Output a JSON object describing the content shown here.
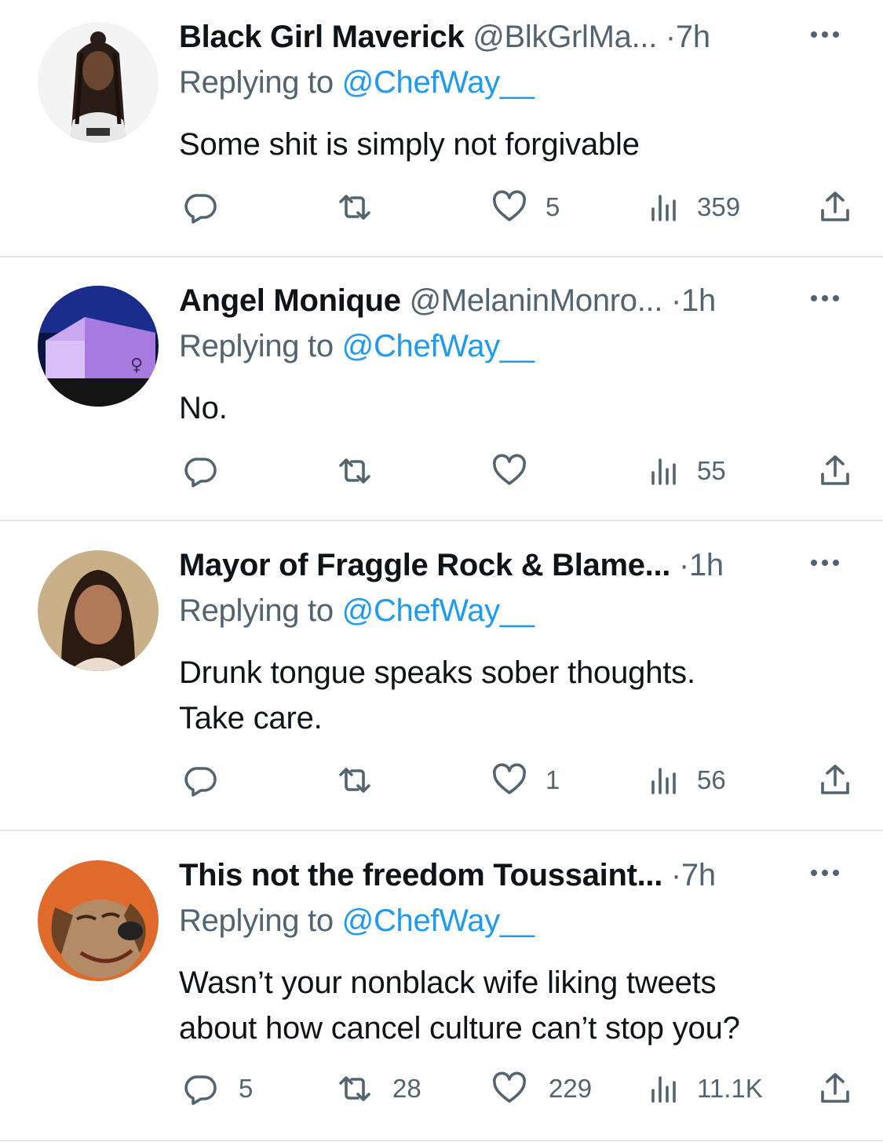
{
  "tweets": [
    {
      "name": "Black Girl Maverick",
      "handle": "@BlkGrlMa...",
      "dot": "·",
      "time": "7h",
      "replying_prefix": "Replying to ",
      "replying_to": "@ChefWay__",
      "text_lines": [
        "Some shit is simply not forgivable"
      ],
      "reply_count": "",
      "retweet_count": "",
      "like_count": "5",
      "view_count": "359"
    },
    {
      "name": "Angel Monique",
      "handle": "@MelaninMonro...",
      "dot": "·",
      "time": "1h",
      "replying_prefix": "Replying to ",
      "replying_to": "@ChefWay__",
      "text_lines": [
        "No."
      ],
      "reply_count": "",
      "retweet_count": "",
      "like_count": "",
      "view_count": "55"
    },
    {
      "name": "Mayor of Fraggle Rock & Blame...",
      "handle": "",
      "dot": "·",
      "time": "1h",
      "replying_prefix": "Replying to ",
      "replying_to": "@ChefWay__",
      "text_lines": [
        "Drunk tongue speaks sober thoughts.",
        "Take care."
      ],
      "reply_count": "",
      "retweet_count": "",
      "like_count": "1",
      "view_count": "56"
    },
    {
      "name": "This not the freedom Toussaint...",
      "handle": "",
      "dot": "·",
      "time": "7h",
      "replying_prefix": "Replying to ",
      "replying_to": "@ChefWay__",
      "text_lines": [
        "Wasn’t your nonblack wife liking tweets",
        "about how cancel culture can’t stop you?"
      ],
      "reply_count": "5",
      "retweet_count": "28",
      "like_count": "229",
      "view_count": "11.1K"
    }
  ],
  "icons": {
    "reply": "reply-icon",
    "retweet": "retweet-icon",
    "like": "heart-icon",
    "views": "views-icon",
    "share": "share-icon",
    "more": "more-icon"
  },
  "colors": {
    "link": "#1d9bf0",
    "secondary_text": "#536471",
    "primary_text": "#0f1419",
    "divider": "#e1e6ea"
  }
}
